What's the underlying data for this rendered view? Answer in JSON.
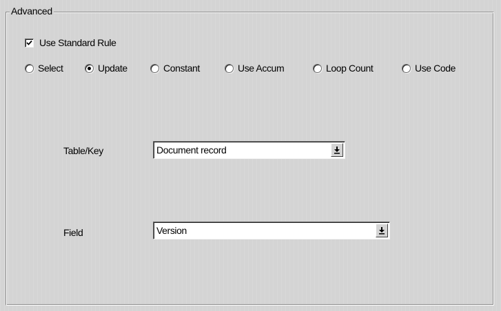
{
  "group": {
    "title": "Advanced"
  },
  "use_standard_rule": {
    "label": "Use Standard Rule",
    "checked": true
  },
  "radio_options": [
    {
      "label": "Select",
      "selected": false
    },
    {
      "label": "Update",
      "selected": true
    },
    {
      "label": "Constant",
      "selected": false
    },
    {
      "label": "Use Accum",
      "selected": false
    },
    {
      "label": "Loop Count",
      "selected": false
    },
    {
      "label": "Use Code",
      "selected": false
    }
  ],
  "table_key": {
    "label": "Table/Key",
    "value": "Document record",
    "icon": "dropdown-arrow-icon"
  },
  "field": {
    "label": "Field",
    "value": "Version",
    "icon": "dropdown-arrow-icon"
  }
}
